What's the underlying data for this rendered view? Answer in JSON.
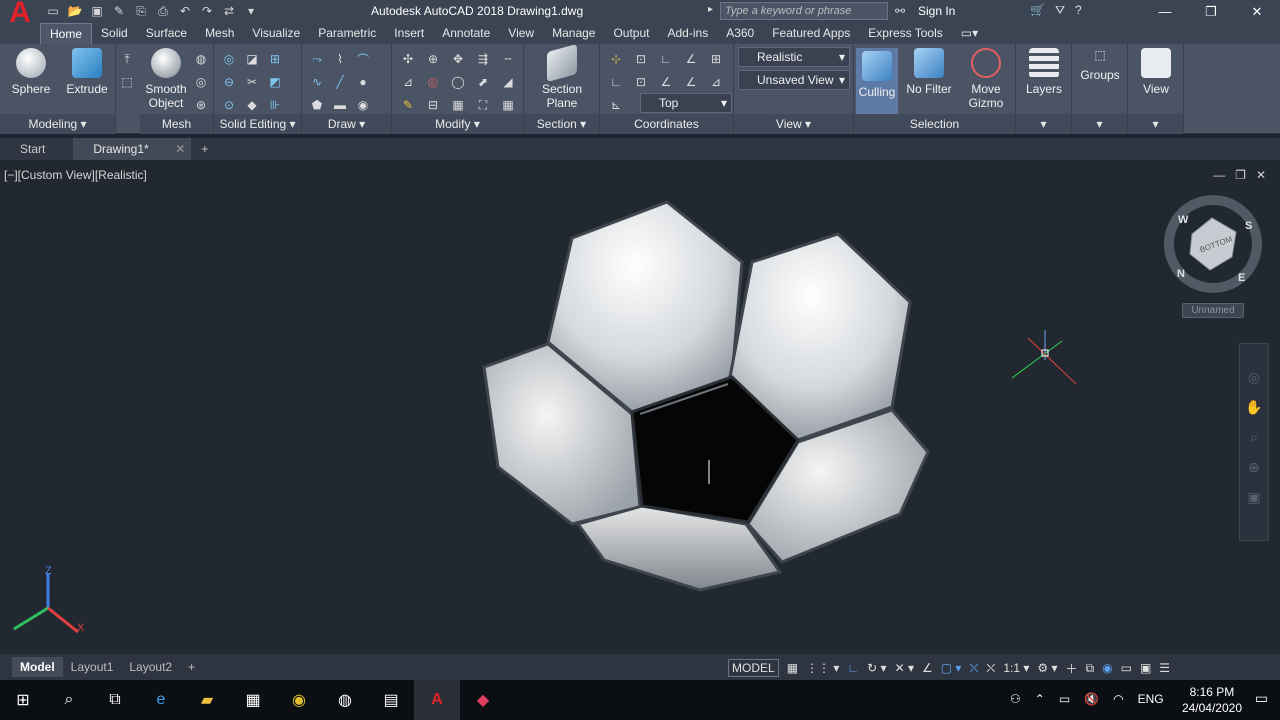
{
  "app": {
    "title": "Autodesk AutoCAD 2018    Drawing1.dwg",
    "logo": "A",
    "search_placeholder": "Type a keyword or phrase",
    "sign_in": "Sign In"
  },
  "ribbon_tabs": [
    "Home",
    "Solid",
    "Surface",
    "Mesh",
    "Visualize",
    "Parametric",
    "Insert",
    "Annotate",
    "View",
    "Manage",
    "Output",
    "Add-ins",
    "A360",
    "Featured Apps",
    "Express Tools"
  ],
  "active_tab": "Home",
  "panels": {
    "modeling": {
      "label": "Modeling ▾",
      "sphere": "Sphere",
      "extrude": "Extrude"
    },
    "mesh": {
      "label": "Mesh",
      "smooth1": "Smooth",
      "smooth2": "Object"
    },
    "solid_editing": {
      "label": "Solid Editing ▾"
    },
    "draw": {
      "label": "Draw ▾"
    },
    "modify": {
      "label": "Modify ▾"
    },
    "section": {
      "label": "Section ▾",
      "btn1": "Section",
      "btn2": "Plane"
    },
    "coordinates": {
      "label": "Coordinates"
    },
    "view": {
      "label": "View ▾",
      "visual_style": "Realistic",
      "saved_view": "Unsaved View",
      "direction": "Top"
    },
    "selection": {
      "label": "Selection",
      "culling": "Culling",
      "filter": "No Filter",
      "gizmo1": "Move",
      "gizmo2": "Gizmo"
    },
    "layers": {
      "label": "Layers"
    },
    "groups": {
      "label": "Groups"
    },
    "viewp": {
      "label": "View"
    }
  },
  "doc_tabs": {
    "start": "Start",
    "drawing": "Drawing1*"
  },
  "viewport": {
    "label": "[−][Custom View][Realistic]",
    "viewcube_named": "Unnamed",
    "compass": {
      "w": "W",
      "s": "S",
      "n": "N",
      "e": "E",
      "face": "BOTTOM"
    }
  },
  "layout_tabs": [
    "Model",
    "Layout1",
    "Layout2"
  ],
  "status": {
    "model": "MODEL",
    "scale": "1:1 ▾"
  },
  "taskbar": {
    "lang": "ENG",
    "time": "8:16 PM",
    "date": "24/04/2020"
  },
  "colors": {
    "accent": "#e0222a",
    "ribbon": "#4b5465",
    "viewport": "#212830"
  }
}
